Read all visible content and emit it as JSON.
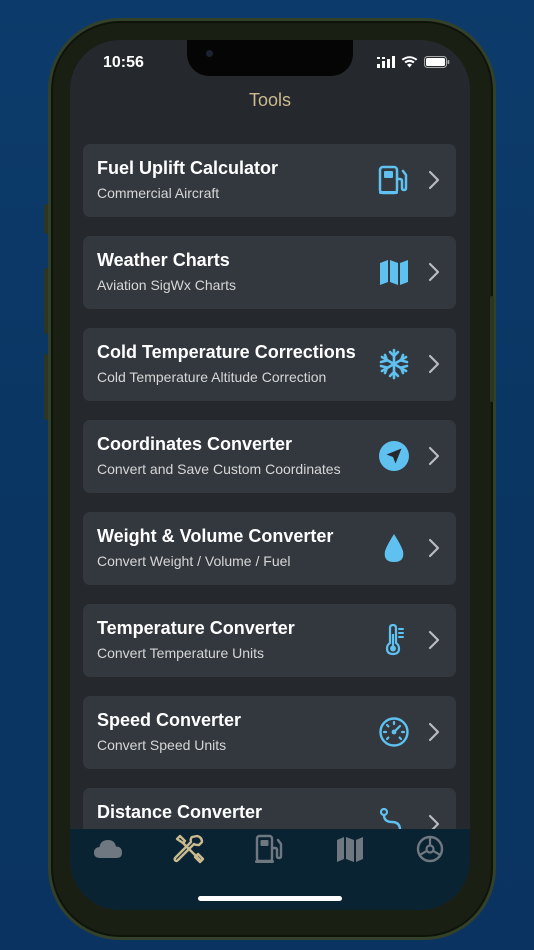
{
  "status": {
    "time": "10:56"
  },
  "header": {
    "title": "Tools"
  },
  "tools": [
    {
      "title": "Fuel Uplift Calculator",
      "subtitle": "Commercial Aircraft",
      "icon": "fuel-pump-icon"
    },
    {
      "title": "Weather Charts",
      "subtitle": "Aviation SigWx Charts",
      "icon": "map-icon"
    },
    {
      "title": "Cold Temperature Corrections",
      "subtitle": "Cold Temperature Altitude Correction",
      "icon": "snowflake-icon"
    },
    {
      "title": "Coordinates Converter",
      "subtitle": "Convert and Save Custom Coordinates",
      "icon": "location-arrow-icon"
    },
    {
      "title": "Weight & Volume Converter",
      "subtitle": "Convert Weight / Volume / Fuel",
      "icon": "droplet-icon"
    },
    {
      "title": "Temperature Converter",
      "subtitle": "Convert Temperature Units",
      "icon": "thermometer-icon"
    },
    {
      "title": "Speed Converter",
      "subtitle": "Convert Speed Units",
      "icon": "speedometer-icon"
    },
    {
      "title": "Distance Converter",
      "subtitle": "",
      "icon": "route-icon"
    }
  ],
  "tabbar": {
    "items": [
      "cloud-icon",
      "tools-icon",
      "fuel-pump-icon",
      "map-icon",
      "settings-icon"
    ],
    "active": "tools-icon"
  },
  "colors": {
    "accent_icon": "#5ec1f0",
    "active_tab": "#cbb98f",
    "inactive_tab": "#6f7880",
    "card_bg": "#33383e",
    "screen_bg": "#25292e",
    "tabbar_bg": "#0a2333",
    "title": "#cbb98f"
  }
}
